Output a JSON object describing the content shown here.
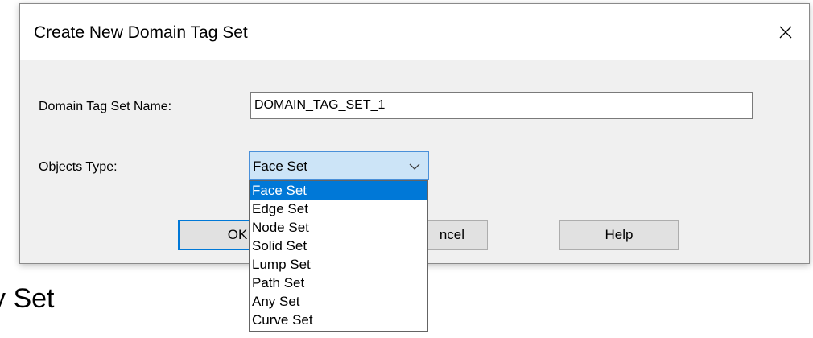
{
  "background_text": "y Set",
  "dialog": {
    "title": "Create New Domain Tag Set",
    "close_icon": "close-icon",
    "fields": {
      "name_label": "Domain Tag Set Name:",
      "name_value": "DOMAIN_TAG_SET_1",
      "type_label": "Objects Type:",
      "type_selected": "Face Set"
    },
    "buttons": {
      "ok_visible": "OK",
      "cancel_visible": "ncel",
      "help": "Help"
    },
    "dropdown": {
      "items": [
        "Face Set",
        "Edge Set",
        "Node Set",
        "Solid Set",
        "Lump Set",
        "Path Set",
        "Any Set",
        "Curve Set"
      ],
      "highlighted": "Face Set"
    }
  },
  "colors": {
    "selection": "#0078d7",
    "combo_focus": "#cce4f7"
  }
}
